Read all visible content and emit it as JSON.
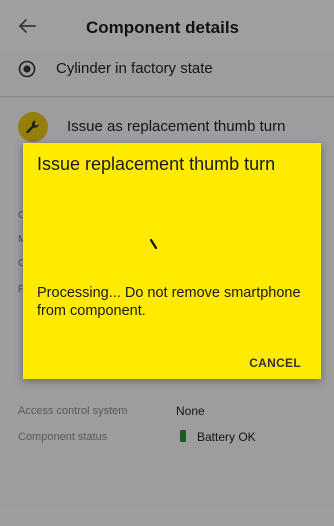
{
  "header": {
    "title": "Component details",
    "back_icon": "arrow-left-icon"
  },
  "state_row": {
    "label": "Cylinder in factory state",
    "icon": "radio-selected-icon"
  },
  "action_row": {
    "label": "Issue as replacement thumb turn",
    "icon": "wrench-icon",
    "accent": "#e3c412"
  },
  "background_rows": [
    {
      "key": "Access control system",
      "value": "None"
    },
    {
      "key": "Component status",
      "value": "Battery OK",
      "status_color": "#2c8a3a"
    }
  ],
  "dialog": {
    "title": "Issue replacement thumb turn",
    "message": "Processing... Do not remove smartphone from component.",
    "cancel_label": "CANCEL",
    "background_color": "#ffeb00"
  }
}
